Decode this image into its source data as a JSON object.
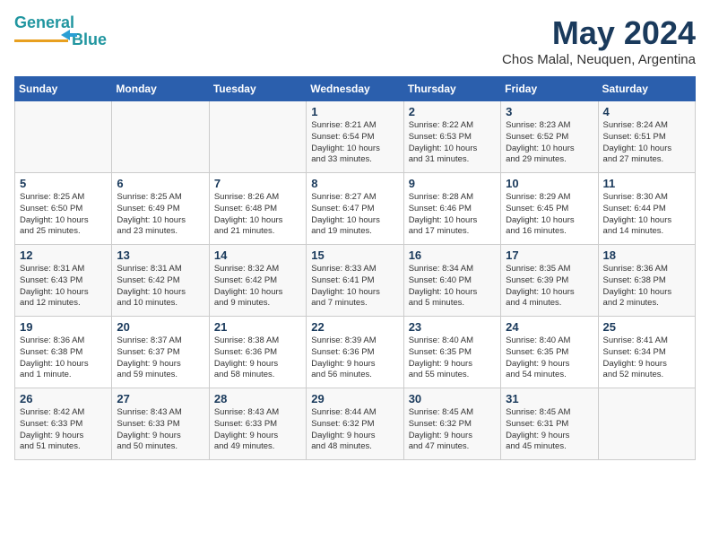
{
  "header": {
    "logo_line1": "General",
    "logo_line2": "Blue",
    "month_title": "May 2024",
    "location": "Chos Malal, Neuquen, Argentina"
  },
  "days_of_week": [
    "Sunday",
    "Monday",
    "Tuesday",
    "Wednesday",
    "Thursday",
    "Friday",
    "Saturday"
  ],
  "weeks": [
    [
      {
        "day": "",
        "info": ""
      },
      {
        "day": "",
        "info": ""
      },
      {
        "day": "",
        "info": ""
      },
      {
        "day": "1",
        "info": "Sunrise: 8:21 AM\nSunset: 6:54 PM\nDaylight: 10 hours\nand 33 minutes."
      },
      {
        "day": "2",
        "info": "Sunrise: 8:22 AM\nSunset: 6:53 PM\nDaylight: 10 hours\nand 31 minutes."
      },
      {
        "day": "3",
        "info": "Sunrise: 8:23 AM\nSunset: 6:52 PM\nDaylight: 10 hours\nand 29 minutes."
      },
      {
        "day": "4",
        "info": "Sunrise: 8:24 AM\nSunset: 6:51 PM\nDaylight: 10 hours\nand 27 minutes."
      }
    ],
    [
      {
        "day": "5",
        "info": "Sunrise: 8:25 AM\nSunset: 6:50 PM\nDaylight: 10 hours\nand 25 minutes."
      },
      {
        "day": "6",
        "info": "Sunrise: 8:25 AM\nSunset: 6:49 PM\nDaylight: 10 hours\nand 23 minutes."
      },
      {
        "day": "7",
        "info": "Sunrise: 8:26 AM\nSunset: 6:48 PM\nDaylight: 10 hours\nand 21 minutes."
      },
      {
        "day": "8",
        "info": "Sunrise: 8:27 AM\nSunset: 6:47 PM\nDaylight: 10 hours\nand 19 minutes."
      },
      {
        "day": "9",
        "info": "Sunrise: 8:28 AM\nSunset: 6:46 PM\nDaylight: 10 hours\nand 17 minutes."
      },
      {
        "day": "10",
        "info": "Sunrise: 8:29 AM\nSunset: 6:45 PM\nDaylight: 10 hours\nand 16 minutes."
      },
      {
        "day": "11",
        "info": "Sunrise: 8:30 AM\nSunset: 6:44 PM\nDaylight: 10 hours\nand 14 minutes."
      }
    ],
    [
      {
        "day": "12",
        "info": "Sunrise: 8:31 AM\nSunset: 6:43 PM\nDaylight: 10 hours\nand 12 minutes."
      },
      {
        "day": "13",
        "info": "Sunrise: 8:31 AM\nSunset: 6:42 PM\nDaylight: 10 hours\nand 10 minutes."
      },
      {
        "day": "14",
        "info": "Sunrise: 8:32 AM\nSunset: 6:42 PM\nDaylight: 10 hours\nand 9 minutes."
      },
      {
        "day": "15",
        "info": "Sunrise: 8:33 AM\nSunset: 6:41 PM\nDaylight: 10 hours\nand 7 minutes."
      },
      {
        "day": "16",
        "info": "Sunrise: 8:34 AM\nSunset: 6:40 PM\nDaylight: 10 hours\nand 5 minutes."
      },
      {
        "day": "17",
        "info": "Sunrise: 8:35 AM\nSunset: 6:39 PM\nDaylight: 10 hours\nand 4 minutes."
      },
      {
        "day": "18",
        "info": "Sunrise: 8:36 AM\nSunset: 6:38 PM\nDaylight: 10 hours\nand 2 minutes."
      }
    ],
    [
      {
        "day": "19",
        "info": "Sunrise: 8:36 AM\nSunset: 6:38 PM\nDaylight: 10 hours\nand 1 minute."
      },
      {
        "day": "20",
        "info": "Sunrise: 8:37 AM\nSunset: 6:37 PM\nDaylight: 9 hours\nand 59 minutes."
      },
      {
        "day": "21",
        "info": "Sunrise: 8:38 AM\nSunset: 6:36 PM\nDaylight: 9 hours\nand 58 minutes."
      },
      {
        "day": "22",
        "info": "Sunrise: 8:39 AM\nSunset: 6:36 PM\nDaylight: 9 hours\nand 56 minutes."
      },
      {
        "day": "23",
        "info": "Sunrise: 8:40 AM\nSunset: 6:35 PM\nDaylight: 9 hours\nand 55 minutes."
      },
      {
        "day": "24",
        "info": "Sunrise: 8:40 AM\nSunset: 6:35 PM\nDaylight: 9 hours\nand 54 minutes."
      },
      {
        "day": "25",
        "info": "Sunrise: 8:41 AM\nSunset: 6:34 PM\nDaylight: 9 hours\nand 52 minutes."
      }
    ],
    [
      {
        "day": "26",
        "info": "Sunrise: 8:42 AM\nSunset: 6:33 PM\nDaylight: 9 hours\nand 51 minutes."
      },
      {
        "day": "27",
        "info": "Sunrise: 8:43 AM\nSunset: 6:33 PM\nDaylight: 9 hours\nand 50 minutes."
      },
      {
        "day": "28",
        "info": "Sunrise: 8:43 AM\nSunset: 6:33 PM\nDaylight: 9 hours\nand 49 minutes."
      },
      {
        "day": "29",
        "info": "Sunrise: 8:44 AM\nSunset: 6:32 PM\nDaylight: 9 hours\nand 48 minutes."
      },
      {
        "day": "30",
        "info": "Sunrise: 8:45 AM\nSunset: 6:32 PM\nDaylight: 9 hours\nand 47 minutes."
      },
      {
        "day": "31",
        "info": "Sunrise: 8:45 AM\nSunset: 6:31 PM\nDaylight: 9 hours\nand 45 minutes."
      },
      {
        "day": "",
        "info": ""
      }
    ]
  ]
}
